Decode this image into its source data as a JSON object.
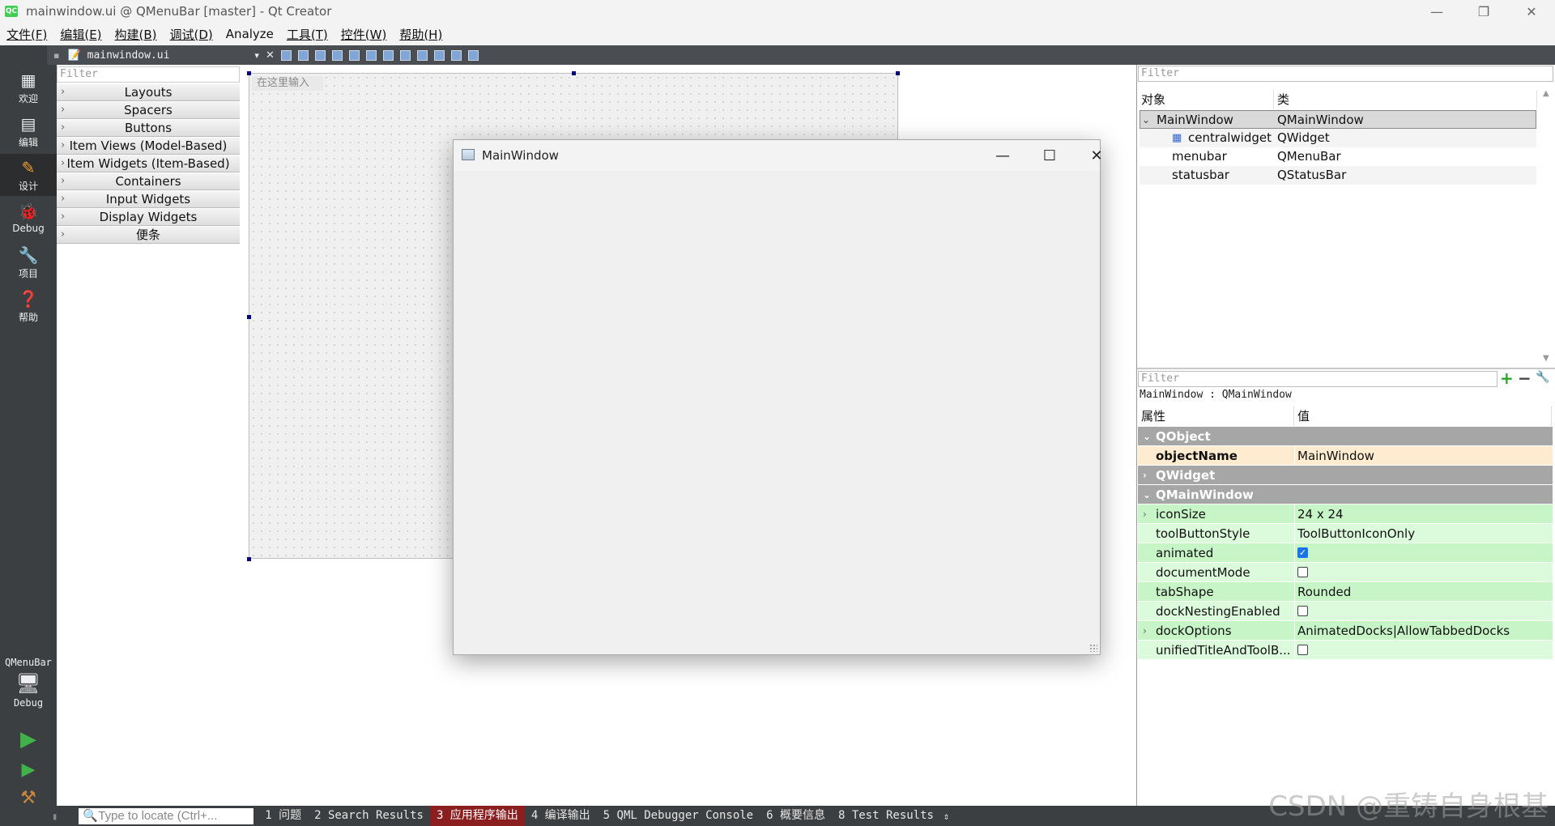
{
  "window": {
    "title": "mainwindow.ui @ QMenuBar [master] - Qt Creator",
    "logo": "QC",
    "controls": {
      "minimize": "—",
      "maximize": "❐",
      "close": "✕"
    }
  },
  "menubar": [
    "文件(F)",
    "编辑(E)",
    "构建(B)",
    "调试(D)",
    "Analyze",
    "工具(T)",
    "控件(W)",
    "帮助(H)"
  ],
  "editor_toolbar": {
    "document": "mainwindow.ui",
    "dropdown": "▾",
    "close": "✕"
  },
  "modes": {
    "welcome": "欢迎",
    "edit": "编辑",
    "design": "设计",
    "debug": "Debug",
    "projects": "项目",
    "help": "帮助",
    "target_kit": "QMenuBar",
    "target_build": "Debug"
  },
  "widget_box": {
    "filter_placeholder": "Filter",
    "categories": [
      "Layouts",
      "Spacers",
      "Buttons",
      "Item Views (Model-Based)",
      "Item Widgets (Item-Based)",
      "Containers",
      "Input Widgets",
      "Display Widgets",
      "便条"
    ]
  },
  "form": {
    "type_here": "在这里输入"
  },
  "preview": {
    "title": "MainWindow",
    "minimize": "—",
    "maximize": "☐",
    "close": "✕"
  },
  "object_inspector": {
    "filter_placeholder": "Filter",
    "col_object": "对象",
    "col_class": "类",
    "rows": [
      {
        "object": "MainWindow",
        "class": "QMainWindow"
      },
      {
        "object": "centralwidget",
        "class": "QWidget"
      },
      {
        "object": "menubar",
        "class": "QMenuBar"
      },
      {
        "object": "statusbar",
        "class": "QStatusBar"
      }
    ]
  },
  "property_editor": {
    "filter_placeholder": "Filter",
    "context": "MainWindow : QMainWindow",
    "col_property": "属性",
    "col_value": "值",
    "groups": {
      "qobject": "QObject",
      "qwidget": "QWidget",
      "qmainwindow": "QMainWindow"
    },
    "props": {
      "objectName": {
        "name": "objectName",
        "value": "MainWindow"
      },
      "iconSize": {
        "name": "iconSize",
        "value": "24 x 24"
      },
      "toolButtonStyle": {
        "name": "toolButtonStyle",
        "value": "ToolButtonIconOnly"
      },
      "animated": {
        "name": "animated",
        "checked": true
      },
      "documentMode": {
        "name": "documentMode",
        "checked": false
      },
      "tabShape": {
        "name": "tabShape",
        "value": "Rounded"
      },
      "dockNestingEnabled": {
        "name": "dockNestingEnabled",
        "checked": false
      },
      "dockOptions": {
        "name": "dockOptions",
        "value": "AnimatedDocks|AllowTabbedDocks"
      },
      "unifiedTitleAndToolBar": {
        "name": "unifiedTitleAndToolB...",
        "checked": false
      }
    },
    "add": "+",
    "remove": "−",
    "wrench": "🔧"
  },
  "bottom": {
    "locator_placeholder": "Type to locate (Ctrl+...",
    "tabs": [
      "1 问题",
      "2 Search Results",
      "3 应用程序输出",
      "4 编译输出",
      "5 QML Debugger Console",
      "6 概要信息",
      "8 Test Results"
    ],
    "active_tab": "3 应用程序输出"
  },
  "watermark": "CSDN @重铸自身根基"
}
